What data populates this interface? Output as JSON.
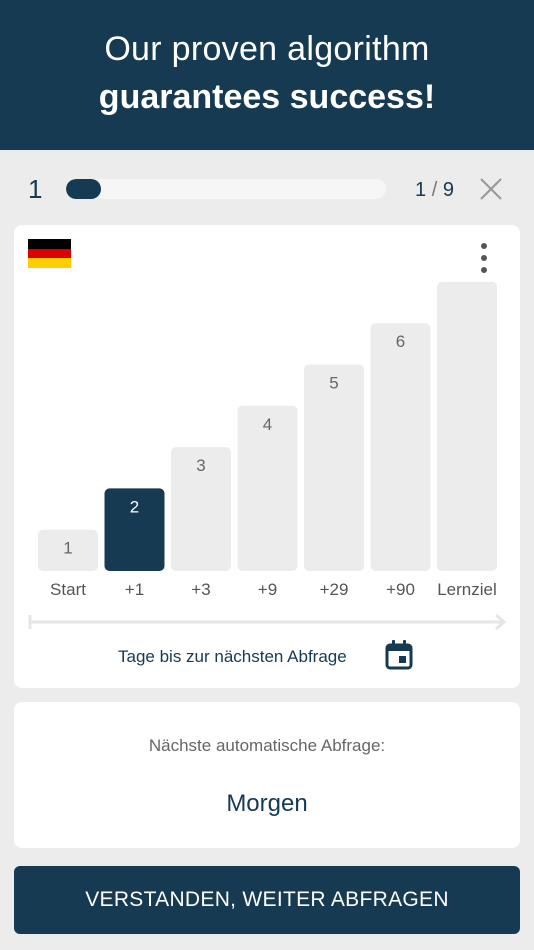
{
  "banner": {
    "line1": "Our proven algorithm",
    "line2": "guarantees success!"
  },
  "progress": {
    "level": "1",
    "current": "1",
    "separator": "/",
    "total": "9",
    "fraction": 0.11
  },
  "card": {
    "flag_icon": "germany-flag-icon",
    "menu_icon": "more-vertical-icon",
    "days_label": "Tage bis zur nächsten Abfrage",
    "calendar_icon": "calendar-icon"
  },
  "chart_data": {
    "type": "bar",
    "categories": [
      "Start",
      "+1",
      "+3",
      "+9",
      "+29",
      "+90",
      "Lernziel"
    ],
    "values": [
      1,
      2,
      3,
      4,
      5,
      6,
      7
    ],
    "bar_labels": [
      "1",
      "2",
      "3",
      "4",
      "5",
      "6",
      ""
    ],
    "highlight_index": 1,
    "ylim": [
      0,
      7
    ],
    "grid": false,
    "colors": {
      "bar": "#ececec",
      "highlight": "#163a52",
      "label": "#666666",
      "highlight_label": "#ffffff"
    }
  },
  "next": {
    "label": "Nächste automatische Abfrage:",
    "value": "Morgen"
  },
  "cta": {
    "label": "VERSTANDEN, WEITER ABFRAGEN"
  },
  "colors": {
    "brand": "#163a52",
    "background": "#ececec",
    "card": "#ffffff"
  }
}
